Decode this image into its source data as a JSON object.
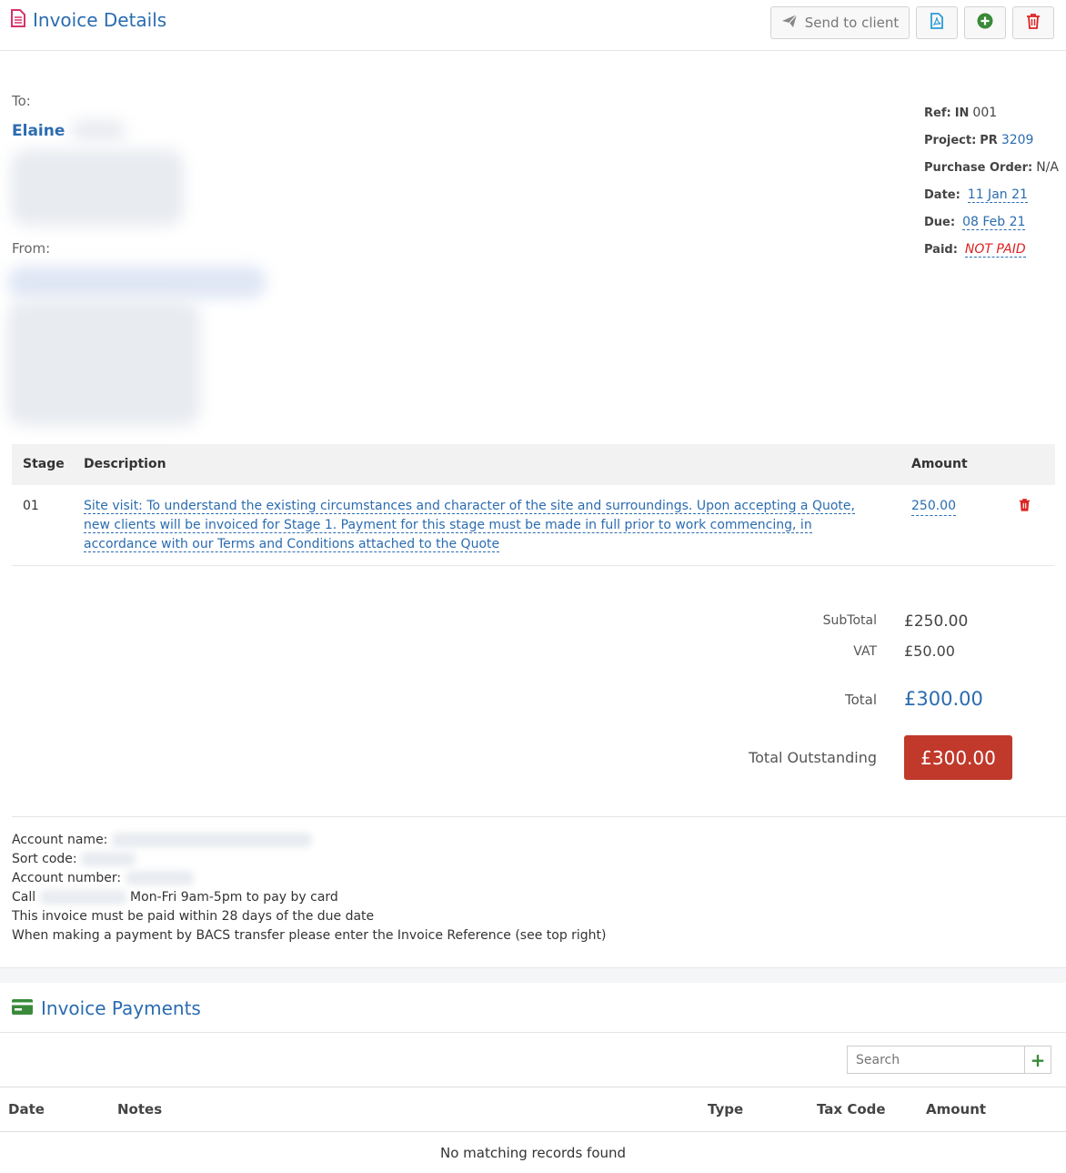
{
  "header": {
    "title": "Invoice Details",
    "send_label": "Send to client",
    "icons": {
      "title": "invoice-doc-icon",
      "send": "paper-plane-icon",
      "pdf": "pdf-icon",
      "add": "plus-circle-icon",
      "delete": "trash-icon"
    }
  },
  "to": {
    "label": "To:",
    "name": "Elaine"
  },
  "from": {
    "label": "From:"
  },
  "meta": {
    "ref_key": "Ref:",
    "ref_prefix": "IN",
    "ref_val": "001",
    "project_key": "Project:",
    "project_prefix": "PR",
    "project_val": "3209",
    "po_key": "Purchase Order:",
    "po_val": "N/A",
    "date_key": "Date:",
    "date_val": "11 Jan 21",
    "due_key": "Due:",
    "due_val": "08 Feb 21",
    "paid_key": "Paid:",
    "paid_val": "NOT PAID"
  },
  "items": {
    "headers": {
      "stage": "Stage",
      "description": "Description",
      "amount": "Amount"
    },
    "rows": [
      {
        "stage": "01",
        "line1": "Site visit: To understand the existing circumstances and character of the site and surroundings. Upon accepting a Quote,",
        "line2": "new clients will be invoiced for Stage 1. Payment for this stage must be made in full prior to work commencing, in",
        "line3": "accordance with our Terms and Conditions attached to the Quote",
        "amount": "250.00"
      }
    ]
  },
  "totals": {
    "subtotal_label": "SubTotal",
    "subtotal": "£250.00",
    "vat_label": "VAT",
    "vat": "£50.00",
    "total_label": "Total",
    "total": "£300.00",
    "outstanding_label": "Total Outstanding",
    "outstanding": "£300.00"
  },
  "bank": {
    "account_name": "Account name:",
    "sort_code": "Sort code:",
    "account_number": "Account number:",
    "call": "Call",
    "call_hours": "Mon-Fri 9am-5pm to pay by card",
    "line5": "This invoice must be paid within 28 days of the due date",
    "line6": "When making a payment by BACS transfer please enter the Invoice Reference (see top right)"
  },
  "payments": {
    "title": "Invoice Payments",
    "icon": "credit-card-icon",
    "search_placeholder": "Search",
    "add_label": "+",
    "headers": {
      "date": "Date",
      "notes": "Notes",
      "type": "Type",
      "tax_code": "Tax Code",
      "amount": "Amount"
    },
    "empty": "No matching records found"
  },
  "colors": {
    "accent": "#2b6cb0",
    "danger": "#c0392b",
    "pdf": "#2b9bd6",
    "add": "#3a8a3a",
    "trash": "#d22"
  }
}
